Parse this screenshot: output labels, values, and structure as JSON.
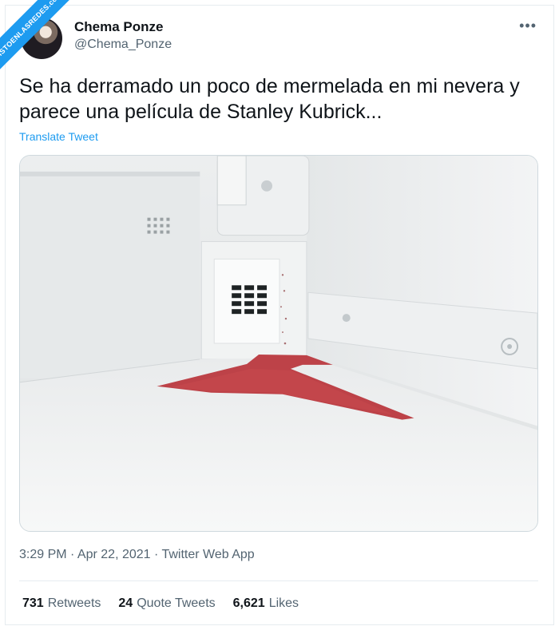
{
  "watermark": {
    "text": "VISTOENLASREDES.com"
  },
  "tweet": {
    "display_name": "Chema Ponze",
    "handle": "@Chema_Ponze",
    "text": "Se ha derramado un poco de mermelada en mi nevera y parece una película de Stanley Kubrick...",
    "translate_label": "Translate Tweet",
    "timestamp": "3:29 PM · Apr 22, 2021 · Twitter Web App",
    "more_icon": "more-horizontal-icon"
  },
  "stats": {
    "retweets": {
      "count": "731",
      "label": "Retweets"
    },
    "quote_tweets": {
      "count": "24",
      "label": "Quote Tweets"
    },
    "likes": {
      "count": "6,621",
      "label": "Likes"
    }
  },
  "colors": {
    "accent": "#1d9bf0",
    "secondary_text": "#536471",
    "jam": "#b8333a"
  }
}
